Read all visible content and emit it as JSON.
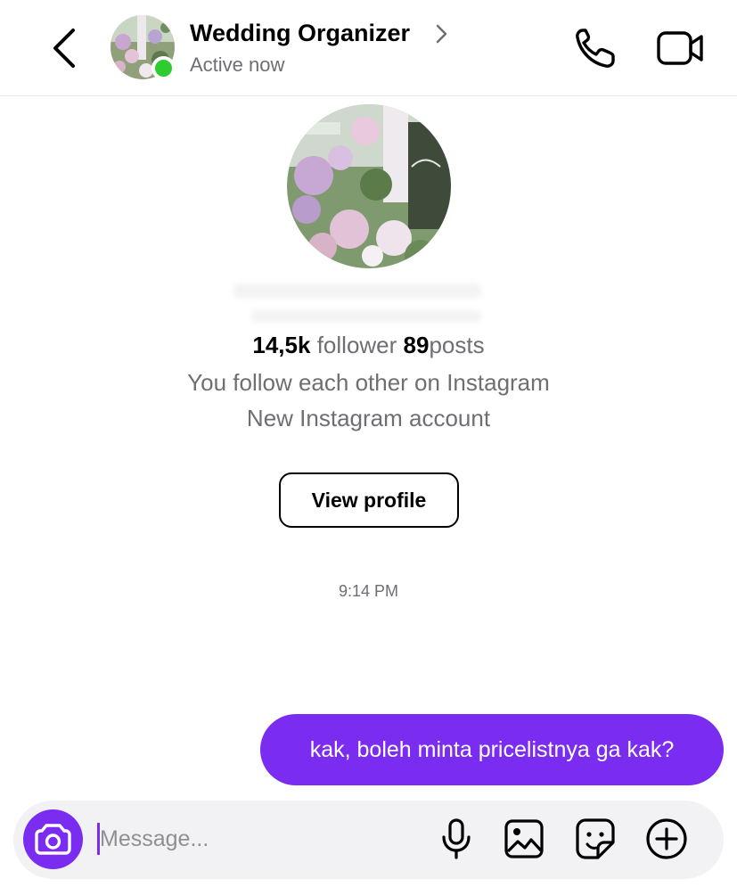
{
  "header": {
    "contact_name": "Wedding Organizer",
    "status": "Active now"
  },
  "profile": {
    "followers_value": "14,5k",
    "followers_label": "follower",
    "posts_value": "89",
    "posts_label": "posts",
    "mutual_text": "You follow each other on Instagram",
    "account_note": "New Instagram account",
    "view_profile_label": "View profile"
  },
  "conversation": {
    "timestamp": "9:14 PM",
    "messages": [
      {
        "sender": "me",
        "text": "kak, boleh minta pricelistnya ga kak?"
      }
    ]
  },
  "composer": {
    "placeholder": "Message..."
  },
  "colors": {
    "accent": "#7a2cf0",
    "online": "#2ecc2e",
    "secondary_text": "#6e6e73",
    "composer_bg": "#f2f2f5"
  },
  "icons": {
    "back": "chevron-left-icon",
    "name_chevron": "chevron-right-icon",
    "call": "phone-icon",
    "video": "video-camera-icon",
    "camera": "camera-icon",
    "mic": "microphone-icon",
    "gallery": "image-icon",
    "sticker": "sticker-icon",
    "more": "plus-circle-icon"
  }
}
